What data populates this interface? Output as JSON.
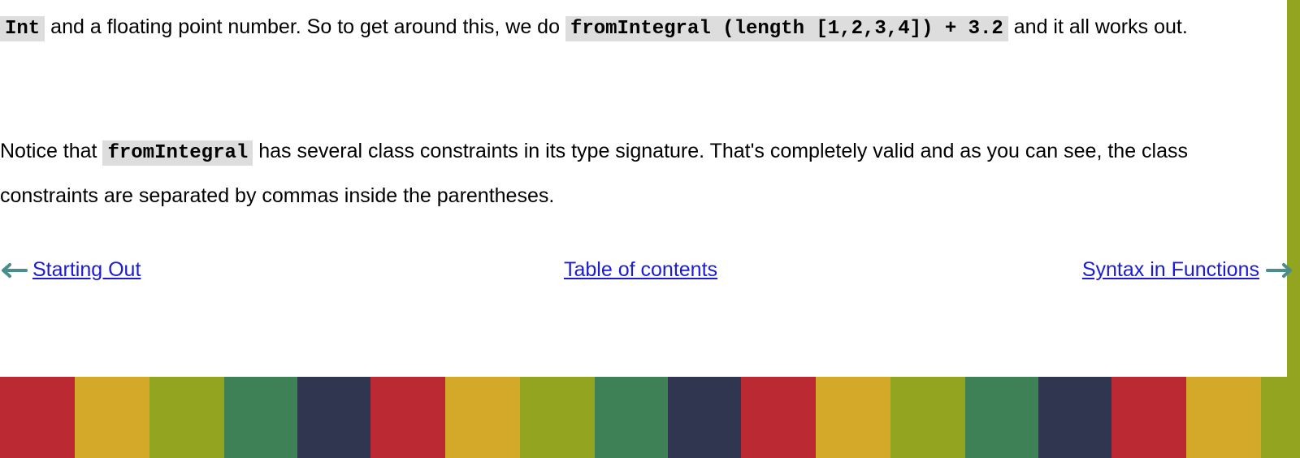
{
  "colors": {
    "link": "#1b1bd6",
    "code_bg": "#dddddd",
    "arrow": "#4a8d8a",
    "side_bar": "#93a420",
    "stripe_pattern": [
      "#bb2a33",
      "#d4a92a",
      "#93a420",
      "#3e8157",
      "#313650"
    ]
  },
  "paragraph1": {
    "code_int": "Int",
    "text_a": " and a floating point number. So to get around this, we do ",
    "code_expr": "fromIntegral (length [1,2,3,4]) + 3.2",
    "text_b": " and it all works out."
  },
  "paragraph2": {
    "text_a": "Notice that ",
    "code_fn": "fromIntegral",
    "text_b": " has several class constraints in its type signature. That's completely valid and as you can see, the class constraints are separated by commas inside the parentheses."
  },
  "nav": {
    "prev_label": "Starting Out",
    "prev_icon": "arrow-left-icon",
    "toc_label": "Table of contents",
    "next_label": "Syntax in Functions",
    "next_icon": "arrow-right-icon"
  }
}
